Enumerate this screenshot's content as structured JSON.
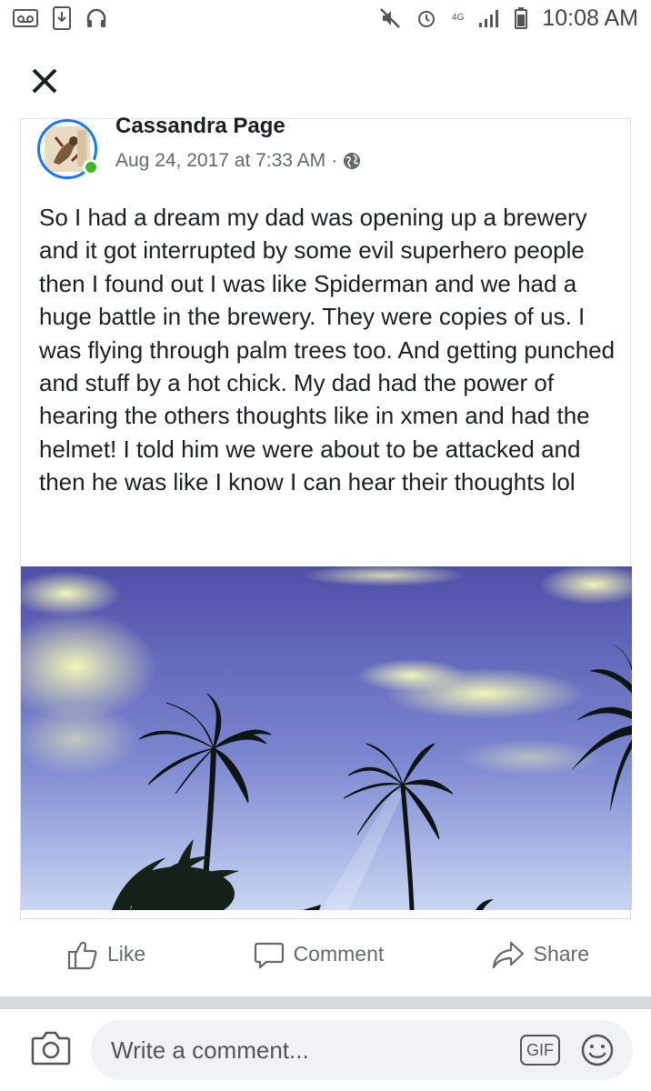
{
  "status_bar": {
    "time": "10:08 AM",
    "network_label": "4G"
  },
  "post": {
    "author": "Cassandra Page",
    "timestamp": "Aug 24, 2017 at 7:33 AM",
    "separator": "·",
    "privacy_icon": "globe-icon",
    "text": "So I had a dream my dad was opening up a brewery and it got interrupted by some evil superhero people then I found out I was like Spiderman and we had a huge battle in the brewery. They were copies of us. I was flying through palm trees too. And getting punched and stuff by a hot chick. My dad had the power of hearing the others thoughts like in xmen and had the helmet! I told him we were about to be attacked and then he was like I know I can hear their thoughts lol"
  },
  "actions": {
    "like": "Like",
    "comment": "Comment",
    "share": "Share"
  },
  "composer": {
    "placeholder": "Write a comment...",
    "gif_label": "GIF"
  },
  "colors": {
    "accent": "#1877f2",
    "online": "#42b72a",
    "muted": "#65676b"
  }
}
